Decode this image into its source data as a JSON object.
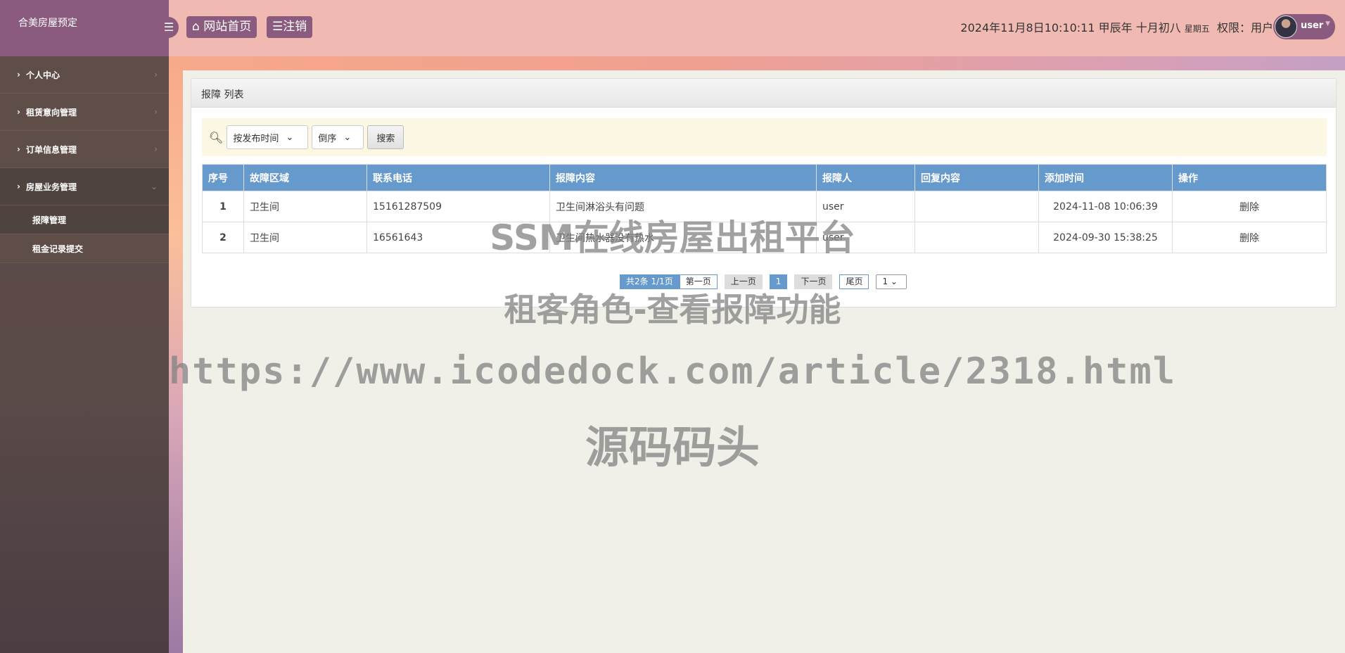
{
  "sidebar": {
    "title": "合美房屋预定",
    "items": [
      {
        "label": "个人中心"
      },
      {
        "label": "租赁意向管理"
      },
      {
        "label": "订单信息管理"
      },
      {
        "label": "房屋业务管理"
      }
    ],
    "sub_items": [
      {
        "label": "报障管理"
      },
      {
        "label": "租金记录提交"
      }
    ]
  },
  "header": {
    "home_label": "网站首页",
    "logout_label": "注销",
    "datetime": "2024年11月8日10:10:11 甲辰年 十月初八",
    "weekday": "星期五",
    "role": "权限：用户",
    "user": "user"
  },
  "panel": {
    "title": "报障 列表",
    "sort_field": "按发布时间",
    "sort_order": "倒序",
    "search_label": "搜索"
  },
  "table": {
    "headers": [
      "序号",
      "故障区域",
      "联系电话",
      "报障内容",
      "报障人",
      "回复内容",
      "添加时间",
      "操作"
    ],
    "rows": [
      [
        "1",
        "卫生间",
        "15161287509",
        "卫生间淋浴头有问题",
        "user",
        "",
        "2024-11-08 10:06:39",
        "删除"
      ],
      [
        "2",
        "卫生间",
        "16561643",
        "卫生间热水器没有热水",
        "user",
        "",
        "2024-09-30 15:38:25",
        "删除"
      ]
    ]
  },
  "pager": {
    "summary": "共2条  1/1页",
    "first": "第一页",
    "prev": "上一页",
    "current": "1",
    "next": "下一页",
    "last": "尾页",
    "select": "1"
  },
  "watermark": {
    "line1": "SSM在线房屋出租平台",
    "line2": "租客角色-查看报障功能",
    "line3": "https://www.icodedock.com/article/2318.html",
    "line4": "源码码头"
  }
}
